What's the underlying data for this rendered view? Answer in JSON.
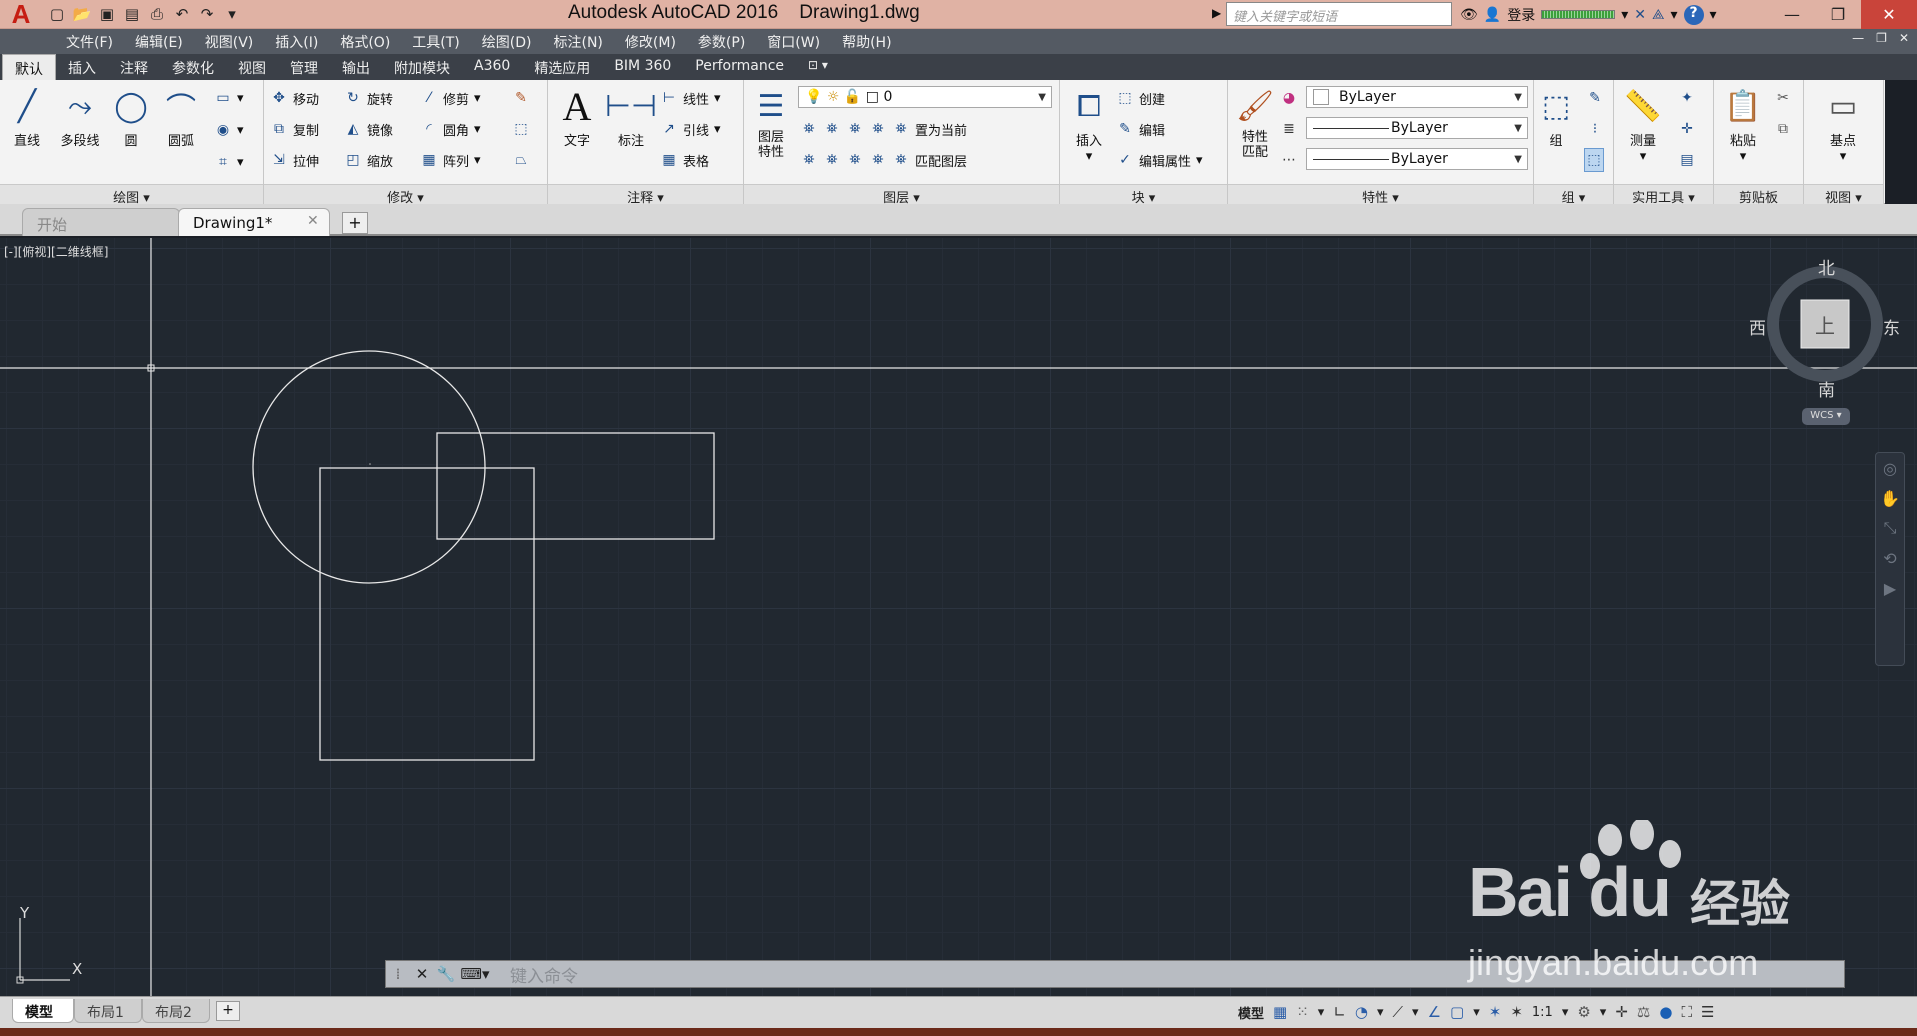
{
  "titlebar": {
    "logo": "A",
    "title": "Autodesk AutoCAD 2016    Drawing1.dwg",
    "search_placeholder": "键入关键字或短语",
    "sign_in": "登录",
    "help": "?"
  },
  "menubar": {
    "items": [
      "文件(F)",
      "编辑(E)",
      "视图(V)",
      "插入(I)",
      "格式(O)",
      "工具(T)",
      "绘图(D)",
      "标注(N)",
      "修改(M)",
      "参数(P)",
      "窗口(W)",
      "帮助(H)"
    ]
  },
  "ribbon_tabs": [
    "默认",
    "插入",
    "注释",
    "参数化",
    "视图",
    "管理",
    "输出",
    "附加模块",
    "A360",
    "精选应用",
    "BIM 360",
    "Performance"
  ],
  "ribbon": {
    "draw": {
      "title": "绘图",
      "tools": [
        "直线",
        "多段线",
        "圆",
        "圆弧"
      ]
    },
    "modify": {
      "title": "修改",
      "tools": [
        "移动",
        "旋转",
        "修剪",
        "复制",
        "镜像",
        "圆角",
        "拉伸",
        "缩放",
        "阵列"
      ]
    },
    "annotation": {
      "title": "注释",
      "big": [
        "文字",
        "标注"
      ],
      "small": [
        "线性",
        "引线",
        "表格"
      ]
    },
    "layers": {
      "title": "图层",
      "big": "图层\n特性",
      "layer_value": "0",
      "set_current": "置为当前",
      "match_layer": "匹配图层"
    },
    "block": {
      "title": "块",
      "big": "插入",
      "small": [
        "创建",
        "编辑",
        "编辑属性"
      ]
    },
    "properties": {
      "title": "特性",
      "big": "特性\n匹配",
      "color": "ByLayer",
      "linetype": "ByLayer",
      "lineweight": "ByLayer"
    },
    "groups": {
      "title": "组",
      "big": "组"
    },
    "utilities": {
      "title": "实用工具",
      "big": "测量"
    },
    "clipboard": {
      "title": "剪贴板",
      "big": "粘贴"
    },
    "view": {
      "title": "视图",
      "big": "基点"
    }
  },
  "file_tabs": {
    "start": "开始",
    "drawing": "Drawing1*"
  },
  "canvas": {
    "viewport_label": "[-][俯视][二维线框]",
    "compass": {
      "north": "北",
      "south": "南",
      "east": "东",
      "west": "西",
      "top": "上"
    },
    "wcs": "WCS",
    "ucs_x": "X",
    "ucs_y": "Y",
    "background": "#212830"
  },
  "command_line": {
    "placeholder": "键入命令"
  },
  "layout_tabs": [
    "模型",
    "布局1",
    "布局2"
  ],
  "status": {
    "mode": "模型",
    "scale": "1:1"
  },
  "watermark": {
    "brand": "Bai du",
    "jing": "经验",
    "url": "jingyan.baidu.com"
  }
}
